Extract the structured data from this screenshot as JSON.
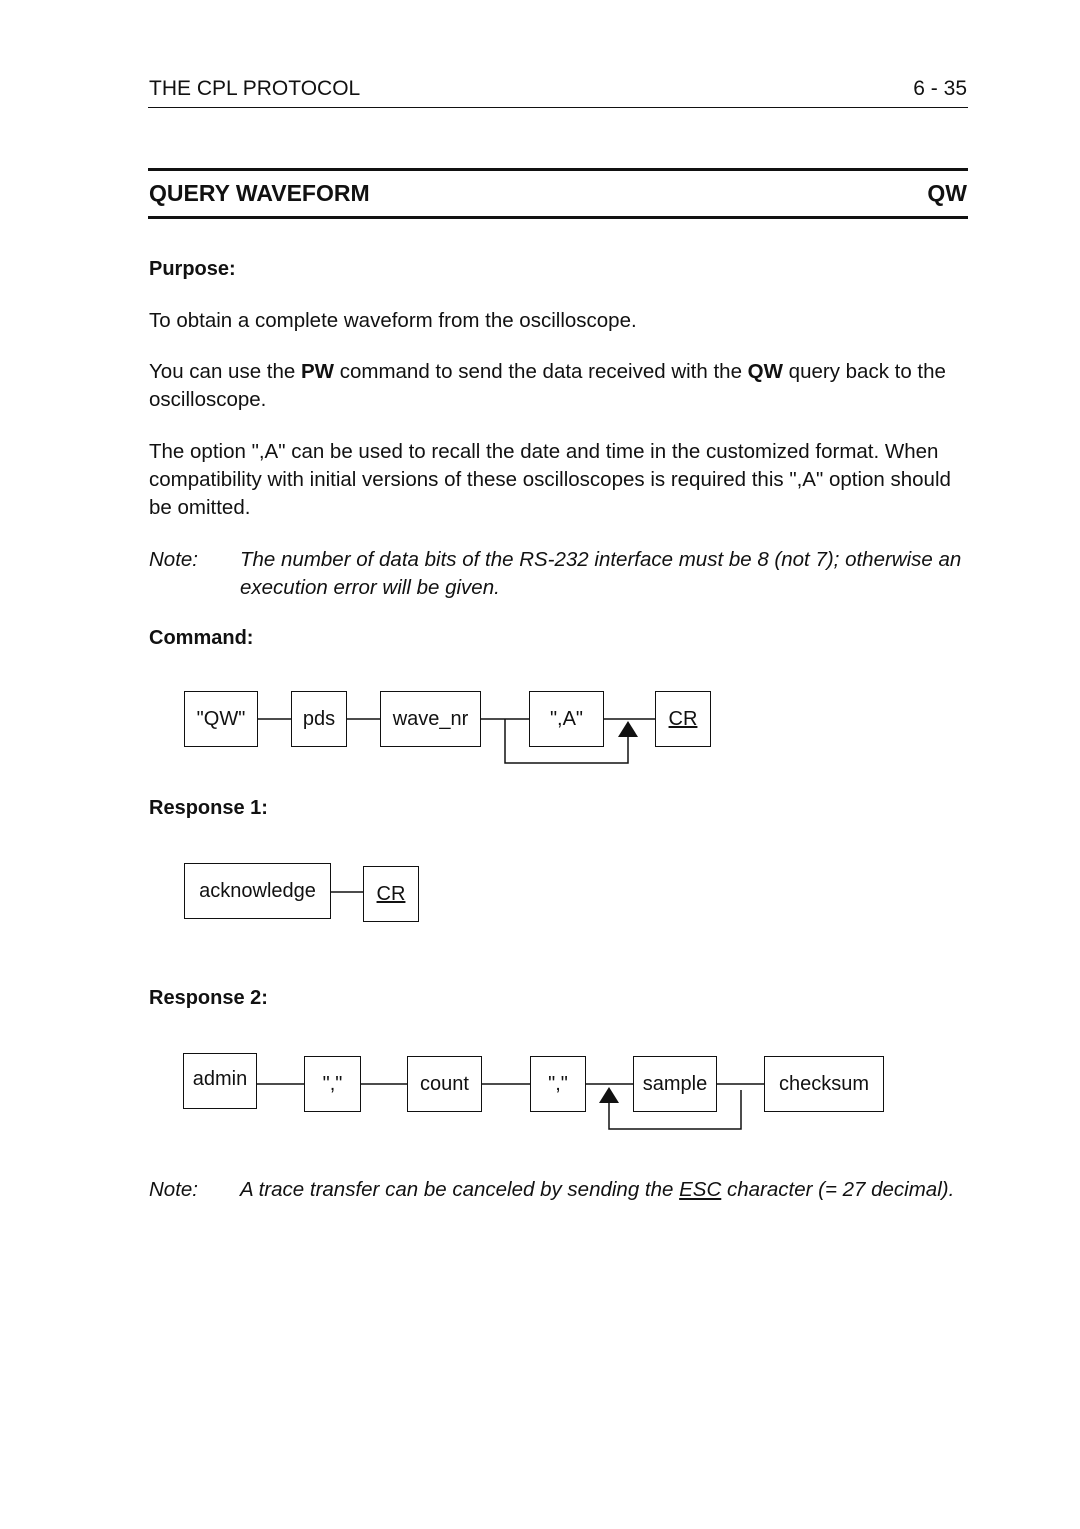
{
  "header": {
    "running_title": "THE CPL PROTOCOL",
    "page_number": "6 - 35"
  },
  "section": {
    "title": "QUERY WAVEFORM",
    "code": "QW"
  },
  "purpose": {
    "heading": "Purpose:",
    "paragraphs": {
      "p1": "To obtain a complete waveform from the oscilloscope.",
      "p2_a": "You can use the ",
      "p2_pw": "PW",
      "p2_b": " command to send the data received with the ",
      "p2_qw": "QW",
      "p2_c": " query back to the oscilloscope.",
      "p3": "The option \",A\" can be used to recall the date and time in the customized format. When compatibility with initial versions of these oscilloscopes is required this \",A\" option should be omitted."
    },
    "note": {
      "label": "Note:",
      "text": "The number of data bits of the RS-232 interface must be 8 (not 7); otherwise an execution error will be given."
    }
  },
  "command": {
    "heading": "Command:",
    "items": [
      "\"QW\"",
      "pds",
      "wave_nr",
      "\",A\"",
      "CR"
    ]
  },
  "response1": {
    "heading": "Response 1:",
    "items": [
      "acknowledge",
      "CR"
    ]
  },
  "response2": {
    "heading": "Response 2:",
    "items": [
      "admin",
      "\",\"",
      "count",
      "\",\"",
      "sample",
      "checksum"
    ]
  },
  "footer_note": {
    "label": "Note:",
    "text_a": "A trace transfer can be canceled by sending the ",
    "esc": "ESC",
    "text_b": " character (= 27 decimal)."
  }
}
